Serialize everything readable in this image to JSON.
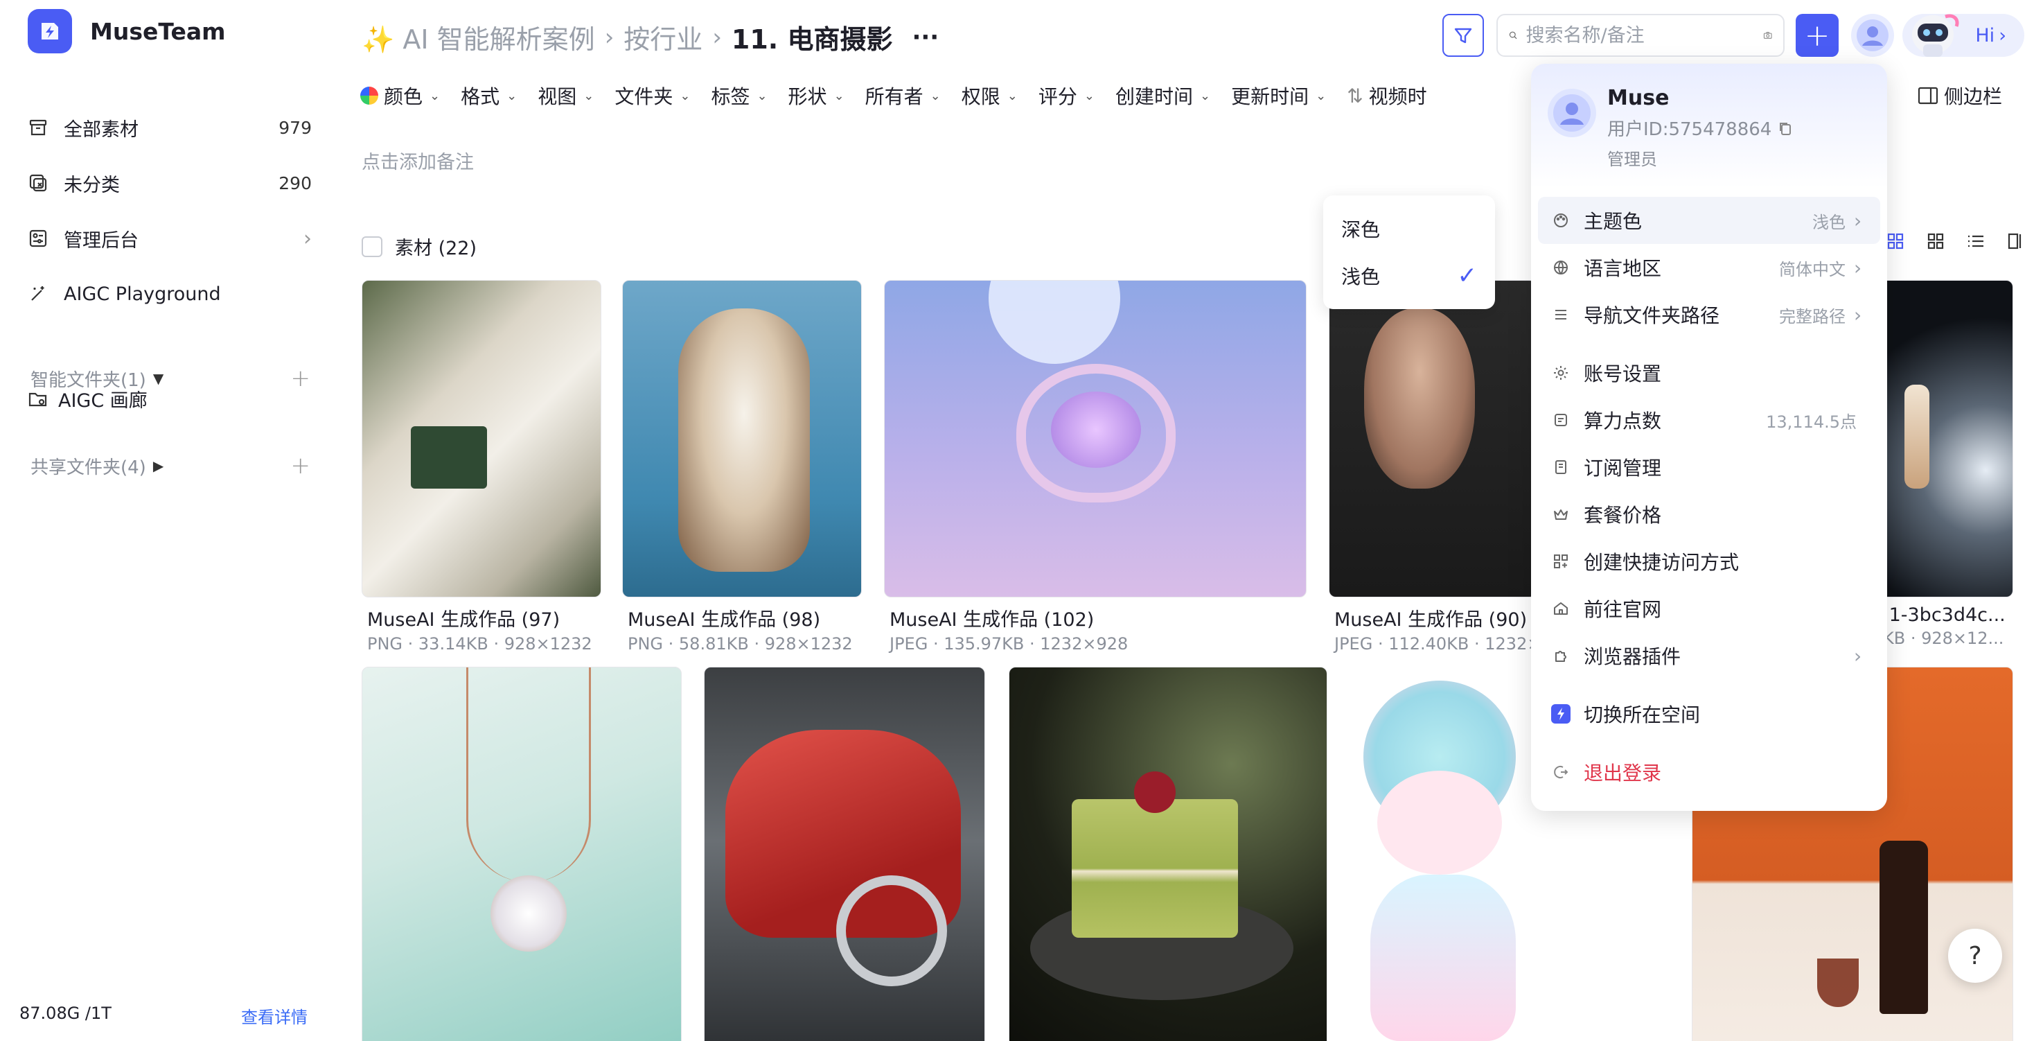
{
  "app": {
    "name": "MuseTeam"
  },
  "sidebar": {
    "items": [
      {
        "label": "全部素材",
        "count": "979"
      },
      {
        "label": "未分类",
        "count": "290"
      },
      {
        "label": "管理后台"
      },
      {
        "label": "AIGC Playground"
      }
    ],
    "smart_folders": "智能文件夹(1)",
    "smart_folder_items": [
      "AIGC 画廊"
    ],
    "shared_folders": "共享文件夹(4)",
    "storage": {
      "used": "87.08G /1T",
      "details": "查看详情"
    }
  },
  "header": {
    "breadcrumb": [
      "✨ AI 智能解析案例",
      "按行业",
      "11. 电商摄影"
    ],
    "more": "···",
    "search_placeholder": "搜索名称/备注",
    "hi": "Hi"
  },
  "toolbar": {
    "filters": [
      "颜色",
      "格式",
      "视图",
      "文件夹",
      "标签",
      "形状",
      "所有者",
      "权限",
      "评分",
      "创建时间",
      "更新时间"
    ],
    "last": "视频时",
    "sidebar_toggle": "侧边栏",
    "note": "点击添加备注",
    "assets_label": "素材 (22)"
  },
  "cards": [
    {
      "name": "MuseAI 生成作品 (97)",
      "meta": "PNG · 33.14KB · 928×1232"
    },
    {
      "name": "MuseAI 生成作品 (98)",
      "meta": "PNG · 58.81KB · 928×1232"
    },
    {
      "name": "MuseAI 生成作品 (102)",
      "meta": "JPEG · 135.97KB · 1232×928"
    },
    {
      "name": "MuseAI 生成作品 (90)",
      "meta": "JPEG · 112.40KB · 1232×"
    },
    {
      "name": ".1-3bc3d4c...",
      "meta": "KB · 928×12..."
    }
  ],
  "theme_menu": {
    "options": [
      "深色",
      "浅色"
    ],
    "selected": "浅色"
  },
  "account": {
    "name": "Muse",
    "user_id": "用户ID:575478864",
    "role": "管理员",
    "menu": [
      {
        "label": "主题色",
        "value": "浅色",
        "chevron": true
      },
      {
        "label": "语言地区",
        "value": "简体中文",
        "chevron": true
      },
      {
        "label": "导航文件夹路径",
        "value": "完整路径",
        "chevron": true
      },
      {
        "label": "账号设置"
      },
      {
        "label": "算力点数",
        "value": "13,114.5点"
      },
      {
        "label": "订阅管理"
      },
      {
        "label": "套餐价格"
      },
      {
        "label": "创建快捷访问方式"
      },
      {
        "label": "前往官网"
      },
      {
        "label": "浏览器插件",
        "chevron": true
      },
      {
        "label": "切换所在空间"
      },
      {
        "label": "退出登录"
      }
    ]
  },
  "help": "?",
  "colors": {
    "accent": "#4a5cf4",
    "danger": "#e0364b",
    "muted": "#9aa0aa"
  }
}
